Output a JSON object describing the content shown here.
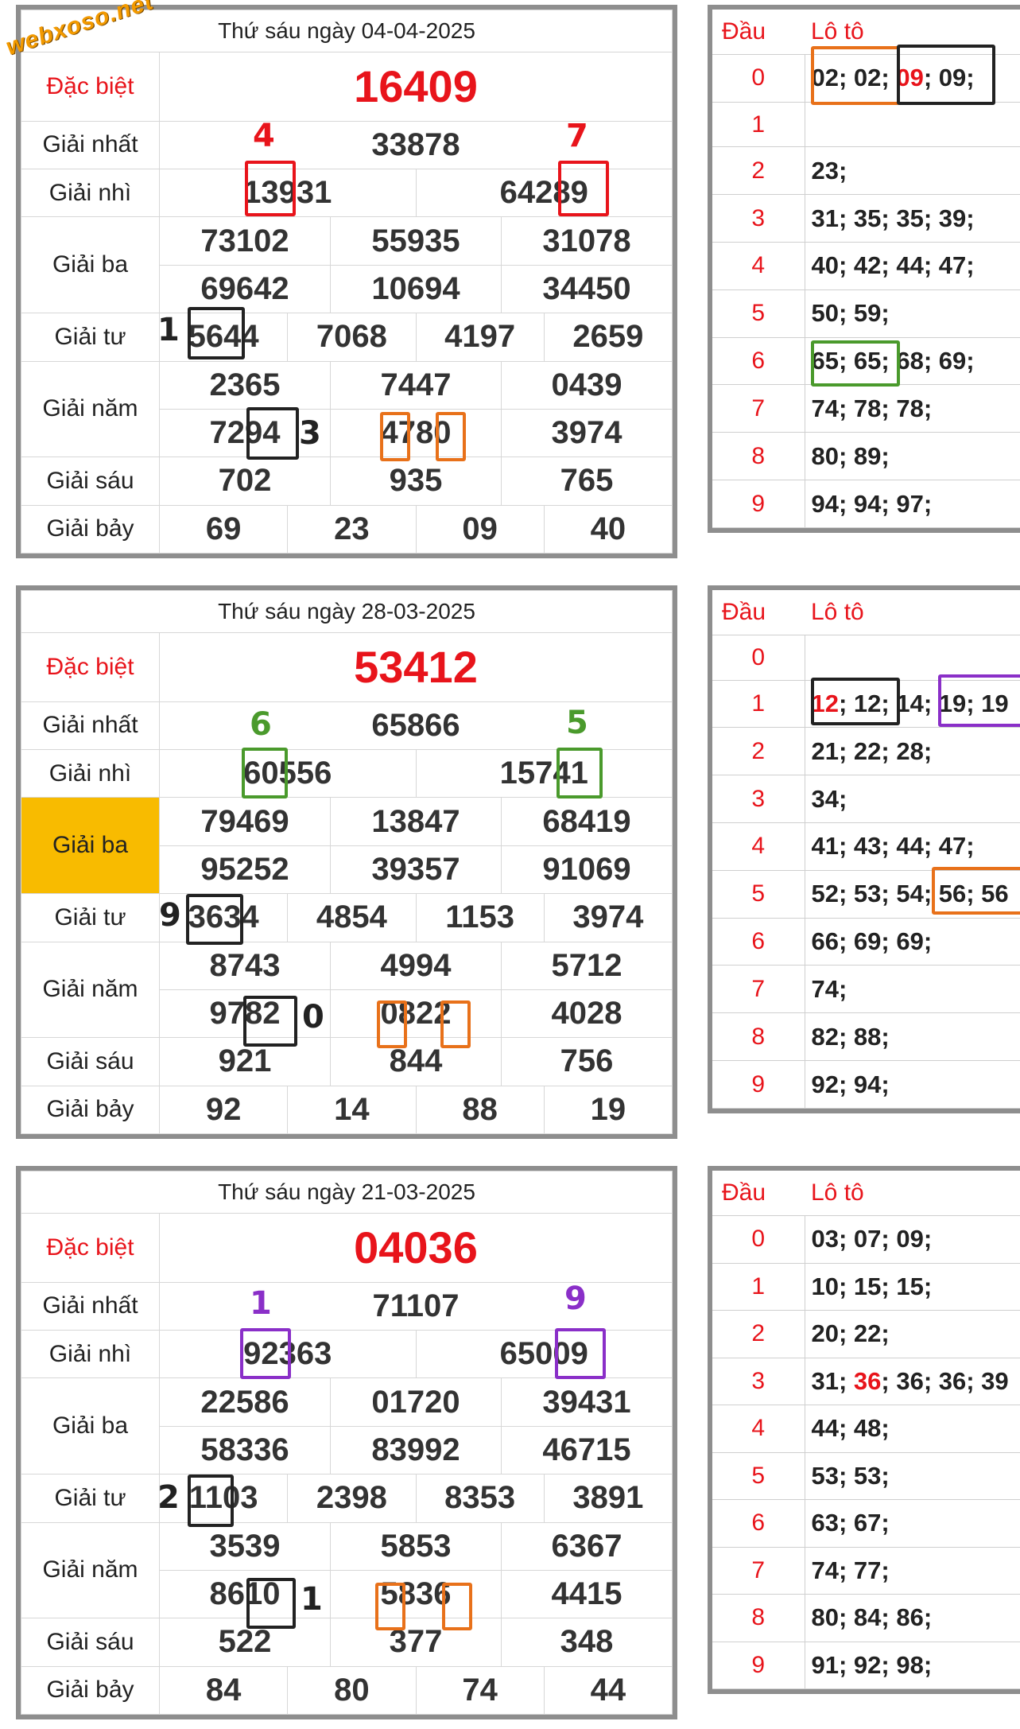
{
  "watermark": "webxoso.net",
  "draws": [
    {
      "date_title": "Thứ sáu ngày 04-04-2025",
      "highlight_giai_ba": false,
      "labels": {
        "dac_biet": "Đặc biệt",
        "nhat": "Giải nhất",
        "nhi": "Giải nhì",
        "ba": "Giải ba",
        "tu": "Giải tư",
        "nam": "Giải năm",
        "sau": "Giải sáu",
        "bay": "Giải bảy"
      },
      "dac_biet": "16409",
      "nhat": "33878",
      "nhi": [
        "13931",
        "64289"
      ],
      "ba": [
        "73102",
        "55935",
        "31078",
        "69642",
        "10694",
        "34450"
      ],
      "tu": [
        "5644",
        "7068",
        "4197",
        "2659"
      ],
      "nam": [
        "2365",
        "7447",
        "0439",
        "7294",
        "4780",
        "3974"
      ],
      "sau": [
        "702",
        "935",
        "765"
      ],
      "bay": [
        "69",
        "23",
        "09",
        "40"
      ],
      "notes": {
        "nhat_left": "4",
        "nhat_right": "7",
        "tu_left": "1",
        "nam_mid": "3"
      },
      "loto_header": {
        "dau": "Đầu",
        "loto": "Lô tô"
      },
      "loto": [
        {
          "dau": "0",
          "pre": "02; 02; ",
          "hot": "09",
          "post": "; 09;"
        },
        {
          "dau": "1",
          "pre": "",
          "hot": "",
          "post": ""
        },
        {
          "dau": "2",
          "pre": "23;",
          "hot": "",
          "post": ""
        },
        {
          "dau": "3",
          "pre": "31; 35; 35; 39;",
          "hot": "",
          "post": ""
        },
        {
          "dau": "4",
          "pre": "40; 42; 44; 47;",
          "hot": "",
          "post": ""
        },
        {
          "dau": "5",
          "pre": "50; 59;",
          "hot": "",
          "post": ""
        },
        {
          "dau": "6",
          "pre": "65; 65; 68; 69;",
          "hot": "",
          "post": ""
        },
        {
          "dau": "7",
          "pre": "74; 78; 78;",
          "hot": "",
          "post": ""
        },
        {
          "dau": "8",
          "pre": "80; 89;",
          "hot": "",
          "post": ""
        },
        {
          "dau": "9",
          "pre": "94; 94; 97;",
          "hot": "",
          "post": ""
        }
      ]
    },
    {
      "date_title": "Thứ sáu ngày 28-03-2025",
      "highlight_giai_ba": true,
      "labels": {
        "dac_biet": "Đặc biệt",
        "nhat": "Giải nhất",
        "nhi": "Giải nhì",
        "ba": "Giải ba",
        "tu": "Giải tư",
        "nam": "Giải năm",
        "sau": "Giải sáu",
        "bay": "Giải bảy"
      },
      "dac_biet": "53412",
      "nhat": "65866",
      "nhi": [
        "60556",
        "15741"
      ],
      "ba": [
        "79469",
        "13847",
        "68419",
        "95252",
        "39357",
        "91069"
      ],
      "tu": [
        "3634",
        "4854",
        "1153",
        "3974"
      ],
      "nam": [
        "8743",
        "4994",
        "5712",
        "9782",
        "0822",
        "4028"
      ],
      "sau": [
        "921",
        "844",
        "756"
      ],
      "bay": [
        "92",
        "14",
        "88",
        "19"
      ],
      "notes": {
        "nhat_left": "6",
        "nhat_right": "5",
        "tu_left": "9",
        "nam_mid": "0"
      },
      "loto_header": {
        "dau": "Đầu",
        "loto": "Lô tô"
      },
      "loto": [
        {
          "dau": "0",
          "pre": "",
          "hot": "",
          "post": ""
        },
        {
          "dau": "1",
          "pre": "",
          "hot": "12",
          "post": "; 12; 14; 19; 19"
        },
        {
          "dau": "2",
          "pre": "21; 22; 28;",
          "hot": "",
          "post": ""
        },
        {
          "dau": "3",
          "pre": "34;",
          "hot": "",
          "post": ""
        },
        {
          "dau": "4",
          "pre": "41; 43; 44; 47;",
          "hot": "",
          "post": ""
        },
        {
          "dau": "5",
          "pre": "52; 53; 54; 56; 56",
          "hot": "",
          "post": ""
        },
        {
          "dau": "6",
          "pre": "66; 69; 69;",
          "hot": "",
          "post": ""
        },
        {
          "dau": "7",
          "pre": "74;",
          "hot": "",
          "post": ""
        },
        {
          "dau": "8",
          "pre": "82; 88;",
          "hot": "",
          "post": ""
        },
        {
          "dau": "9",
          "pre": "92; 94;",
          "hot": "",
          "post": ""
        }
      ]
    },
    {
      "date_title": "Thứ sáu ngày 21-03-2025",
      "highlight_giai_ba": false,
      "labels": {
        "dac_biet": "Đặc biệt",
        "nhat": "Giải nhất",
        "nhi": "Giải nhì",
        "ba": "Giải ba",
        "tu": "Giải tư",
        "nam": "Giải năm",
        "sau": "Giải sáu",
        "bay": "Giải bảy"
      },
      "dac_biet": "04036",
      "nhat": "71107",
      "nhi": [
        "92363",
        "65009"
      ],
      "ba": [
        "22586",
        "01720",
        "39431",
        "58336",
        "83992",
        "46715"
      ],
      "tu": [
        "1103",
        "2398",
        "8353",
        "3891"
      ],
      "nam": [
        "3539",
        "5853",
        "6367",
        "8610",
        "5836",
        "4415"
      ],
      "sau": [
        "522",
        "377",
        "348"
      ],
      "bay": [
        "84",
        "80",
        "74",
        "44"
      ],
      "notes": {
        "nhat_left": "1",
        "nhat_right": "9",
        "tu_left": "2",
        "nam_mid": "1"
      },
      "loto_header": {
        "dau": "Đầu",
        "loto": "Lô tô"
      },
      "loto": [
        {
          "dau": "0",
          "pre": "03; 07; 09;",
          "hot": "",
          "post": ""
        },
        {
          "dau": "1",
          "pre": "10; 15; 15;",
          "hot": "",
          "post": ""
        },
        {
          "dau": "2",
          "pre": "20; 22;",
          "hot": "",
          "post": ""
        },
        {
          "dau": "3",
          "pre": "31; ",
          "hot": "36",
          "post": "; 36; 36; 39"
        },
        {
          "dau": "4",
          "pre": "44; 48;",
          "hot": "",
          "post": ""
        },
        {
          "dau": "5",
          "pre": "53; 53;",
          "hot": "",
          "post": ""
        },
        {
          "dau": "6",
          "pre": "63; 67;",
          "hot": "",
          "post": ""
        },
        {
          "dau": "7",
          "pre": "74; 77;",
          "hot": "",
          "post": ""
        },
        {
          "dau": "8",
          "pre": "80; 84; 86;",
          "hot": "",
          "post": ""
        },
        {
          "dau": "9",
          "pre": "91; 92; 98;",
          "hot": "",
          "post": ""
        }
      ]
    }
  ],
  "colors": {
    "red": "#e8141b",
    "orange": "#e8711a",
    "black": "#222222",
    "green": "#4a9a2c",
    "purple": "#8a2fc8",
    "highlight": "#f8bb00",
    "border": "#8e8e8e"
  }
}
